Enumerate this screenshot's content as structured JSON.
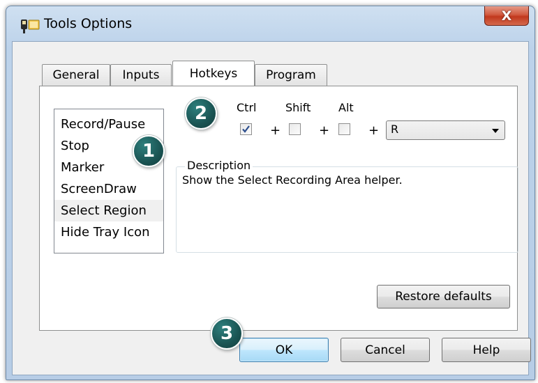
{
  "window": {
    "title": "Tools Options",
    "close_label": "X"
  },
  "tabs": [
    {
      "label": "General",
      "active": false
    },
    {
      "label": "Inputs",
      "active": false
    },
    {
      "label": "Hotkeys",
      "active": true
    },
    {
      "label": "Program",
      "active": false
    }
  ],
  "hotkey_list": {
    "items": [
      "Record/Pause",
      "Stop",
      "Marker",
      "ScreenDraw",
      "Select Region",
      "Hide Tray Icon"
    ],
    "selected": "Select Region"
  },
  "modifiers": {
    "ctrl_label": "Ctrl",
    "shift_label": "Shift",
    "alt_label": "Alt",
    "ctrl_checked": true,
    "shift_checked": false,
    "alt_checked": false,
    "plus": "+"
  },
  "key_select": {
    "value": "R"
  },
  "description": {
    "legend": "Description",
    "text": "Show the Select Recording Area helper."
  },
  "buttons": {
    "restore_defaults": "Restore defaults",
    "ok": "OK",
    "cancel": "Cancel",
    "help": "Help"
  },
  "callouts": {
    "one": "1",
    "two": "2",
    "three": "3"
  },
  "colors": {
    "callout": "#1a5453",
    "close_button": "#c1381d",
    "default_button_border": "#3c7fb1"
  }
}
